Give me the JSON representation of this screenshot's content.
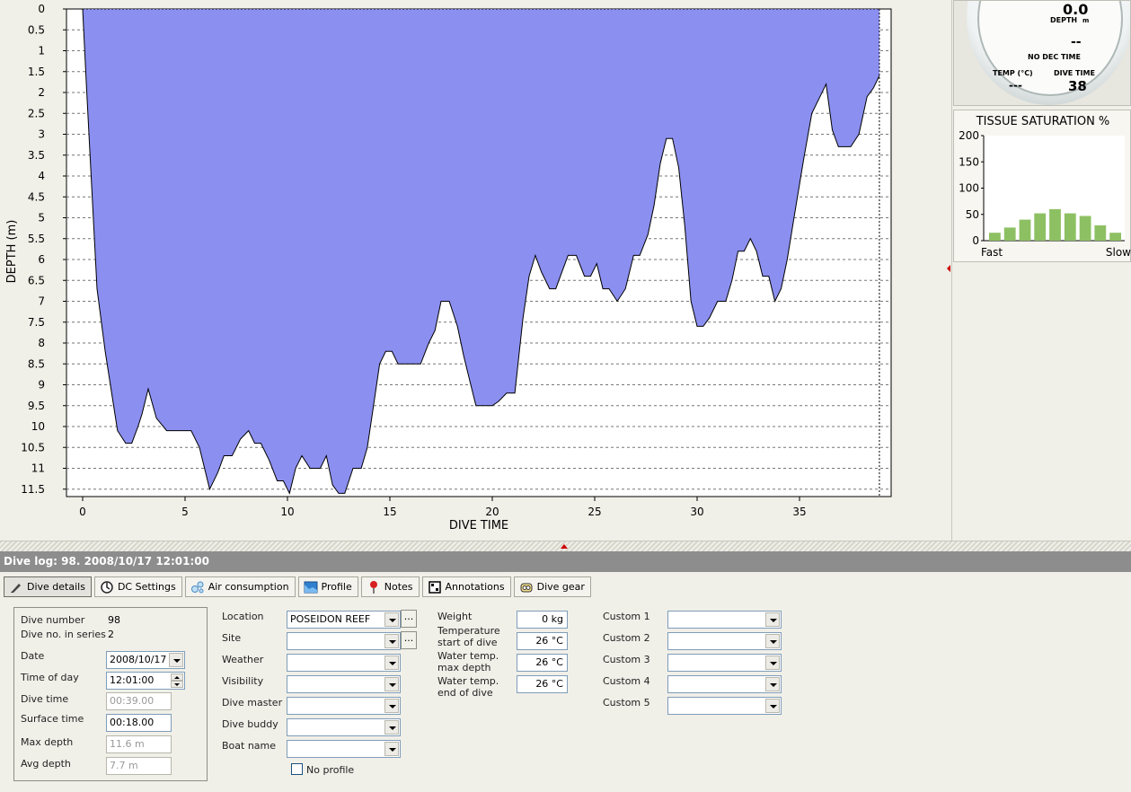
{
  "chart_data": {
    "type": "area",
    "xlabel": "DIVE TIME",
    "ylabel": "DEPTH (m)",
    "xlim": [
      0,
      39
    ],
    "ylim": [
      11.6,
      0
    ],
    "y_inverted": true,
    "x_ticks": [
      0,
      5,
      10,
      15,
      20,
      25,
      30,
      35
    ],
    "y_ticks": [
      "0",
      "0.5",
      "1",
      "1.5",
      "2",
      "2.5",
      "3",
      "3.5",
      "4",
      "4.5",
      "5",
      "5.5",
      "6",
      "6.5",
      "7",
      "7.5",
      "8",
      "8.5",
      "9",
      "9.5",
      "10",
      "10.5",
      "11",
      "11.5"
    ],
    "grid": "horizontal-dashed",
    "fill_color": "#8b8ff0",
    "line_color": "#000000",
    "series": [
      {
        "x": [
          0,
          0.2,
          0.7,
          1.1,
          1.7,
          2.1,
          2.4,
          2.7,
          2.9,
          3.2,
          3.6,
          4.1,
          4.4,
          4.9,
          5.3,
          5.7,
          6.2,
          6.6,
          6.9,
          7.3,
          7.7,
          8.1,
          8.4,
          8.7,
          9.1,
          9.5,
          9.8,
          10.1,
          10.4,
          10.7,
          11.1,
          11.6,
          11.9,
          12.2,
          12.5,
          12.8,
          13.2,
          13.6,
          13.9,
          14.2,
          14.5,
          14.8,
          15.1,
          15.4,
          15.8,
          16.2,
          16.5,
          16.9,
          17.2,
          17.5,
          17.9,
          18.3,
          18.6,
          18.9,
          19.2,
          19.6,
          20.0,
          20.3,
          20.7,
          21.1,
          21.5,
          21.8,
          22.1,
          22.4,
          22.8,
          23.1,
          23.4,
          23.7,
          24.1,
          24.5,
          24.8,
          25.1,
          25.4,
          25.7,
          26.1,
          26.5,
          26.9,
          27.2,
          27.6,
          27.9,
          28.2,
          28.5,
          28.8,
          29.1,
          29.4,
          29.7,
          30.0,
          30.3,
          30.6,
          31.0,
          31.4,
          31.7,
          32.0,
          32.3,
          32.6,
          32.9,
          33.2,
          33.5,
          33.8,
          34.1,
          34.4,
          34.8,
          35.2,
          35.6,
          36.0,
          36.3,
          36.6,
          36.9,
          37.2,
          37.5,
          37.9,
          38.3,
          38.6,
          38.9
        ],
        "y": [
          0,
          2.0,
          6.7,
          8.2,
          10.1,
          10.4,
          10.4,
          10.0,
          9.7,
          9.1,
          9.8,
          10.1,
          10.1,
          10.1,
          10.1,
          10.5,
          11.5,
          11.1,
          10.7,
          10.7,
          10.3,
          10.1,
          10.4,
          10.4,
          10.8,
          11.3,
          11.3,
          11.6,
          11.0,
          10.7,
          11.0,
          11.0,
          10.7,
          11.4,
          11.6,
          11.6,
          11.0,
          11.0,
          10.5,
          9.5,
          8.5,
          8.2,
          8.2,
          8.5,
          8.5,
          8.5,
          8.5,
          8.0,
          7.7,
          7.0,
          7.0,
          7.6,
          8.3,
          8.9,
          9.5,
          9.5,
          9.5,
          9.4,
          9.2,
          9.2,
          7.4,
          6.4,
          5.9,
          6.3,
          6.7,
          6.7,
          6.3,
          5.9,
          5.9,
          6.4,
          6.4,
          6.1,
          6.7,
          6.7,
          7.0,
          6.7,
          5.9,
          5.9,
          5.4,
          4.7,
          3.7,
          3.1,
          3.1,
          3.8,
          5.2,
          7.0,
          7.6,
          7.6,
          7.4,
          7.0,
          7.0,
          6.5,
          5.8,
          5.8,
          5.5,
          5.8,
          6.4,
          6.4,
          7.0,
          6.7,
          6.0,
          4.8,
          3.6,
          2.5,
          2.1,
          1.8,
          2.9,
          3.3,
          3.3,
          3.3,
          3.0,
          2.1,
          1.9,
          1.6
        ]
      }
    ]
  },
  "gauge": {
    "depth_value": "0.0",
    "depth_label": "DEPTH",
    "depth_unit": "m",
    "ndl_value": "--",
    "ndl_label": "NO DEC TIME",
    "temp_label": "TEMP (°C)",
    "temp_value": "---",
    "dive_time_label": "DIVE TIME",
    "dive_time_value": "38"
  },
  "tissue_chart": {
    "title": "TISSUE SATURATION %",
    "type": "bar",
    "y_ticks": [
      "200",
      "150",
      "100",
      "50",
      "0"
    ],
    "ylim": [
      0,
      200
    ],
    "values": [
      15,
      25,
      40,
      52,
      60,
      52,
      47,
      29,
      15
    ],
    "x_left_label": "Fast",
    "x_right_label": "Slow",
    "bar_color": "#8dc063"
  },
  "log_header": {
    "title": "Dive log: 98. 2008/10/17 12:01:00"
  },
  "tabs": [
    {
      "label": "Dive details",
      "icon": "pen-icon",
      "active": true
    },
    {
      "label": "DC Settings",
      "icon": "dive-computer-icon",
      "active": false
    },
    {
      "label": "Air consumption",
      "icon": "bubbles-icon",
      "active": false
    },
    {
      "label": "Profile",
      "icon": "profile-icon",
      "active": false
    },
    {
      "label": "Notes",
      "icon": "pin-icon",
      "active": false
    },
    {
      "label": "Annotations",
      "icon": "annotation-icon",
      "active": false
    },
    {
      "label": "Dive gear",
      "icon": "dive-gear-icon",
      "active": false
    }
  ],
  "details": {
    "dive_number_label": "Dive number",
    "dive_number": "98",
    "series_label": "Dive no. in series",
    "series": "2",
    "date_label": "Date",
    "date": "2008/10/17",
    "time_label": "Time of day",
    "time": "12:01:00",
    "dive_time_label": "Dive time",
    "dive_time": "00:39.00",
    "surface_label": "Surface time",
    "surface": "00:18.00",
    "max_depth_label": "Max depth",
    "max_depth": "11.6 m",
    "avg_depth_label": "Avg depth",
    "avg_depth": "7.7 m"
  },
  "location": {
    "location_label": "Location",
    "location": "POSEIDON REEF",
    "site_label": "Site",
    "weather_label": "Weather",
    "visibility_label": "Visibility",
    "dive_master_label": "Dive master",
    "dive_buddy_label": "Dive buddy",
    "boat_name_label": "Boat name",
    "no_profile_label": "No profile",
    "ellipsis": "..."
  },
  "conditions": {
    "weight_label": "Weight",
    "weight": "0 kg",
    "temp_start_label_1": "Temperature",
    "temp_start_label_2": "start of dive",
    "temp_start": "26 °C",
    "temp_max_label_1": "Water temp.",
    "temp_max_label_2": "max depth",
    "temp_max": "26 °C",
    "temp_end_label_1": "Water temp.",
    "temp_end_label_2": "end of dive",
    "temp_end": "26 °C"
  },
  "custom": {
    "custom1_label": "Custom 1",
    "custom2_label": "Custom 2",
    "custom3_label": "Custom 3",
    "custom4_label": "Custom 4",
    "custom5_label": "Custom 5"
  }
}
